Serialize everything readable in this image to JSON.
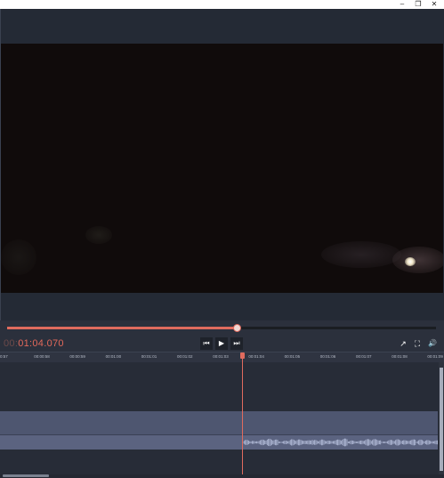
{
  "window": {
    "minimize_glyph": "–",
    "restore_glyph": "❐",
    "close_glyph": "✕"
  },
  "scrubber": {
    "progress": 0.535,
    "fill_color": "#e06b5e"
  },
  "timecode": {
    "dim": "00:",
    "lit": "01:04.070"
  },
  "transport": {
    "prev_glyph": "⏮",
    "play_glyph": "▶",
    "next_glyph": "⏭"
  },
  "right_controls": {
    "export_glyph": "↗",
    "fullscreen_glyph": "⛶",
    "volume_glyph": "🔊"
  },
  "ruler": {
    "labels": [
      "0:57",
      "00:00:58",
      "00:00:59",
      "00:01:00",
      "00:01:01",
      "00:01:02",
      "00:01:03",
      "00:01:04",
      "00:01:05",
      "00:01:06",
      "00:01:07",
      "00:01:08",
      "00:01:09"
    ]
  }
}
